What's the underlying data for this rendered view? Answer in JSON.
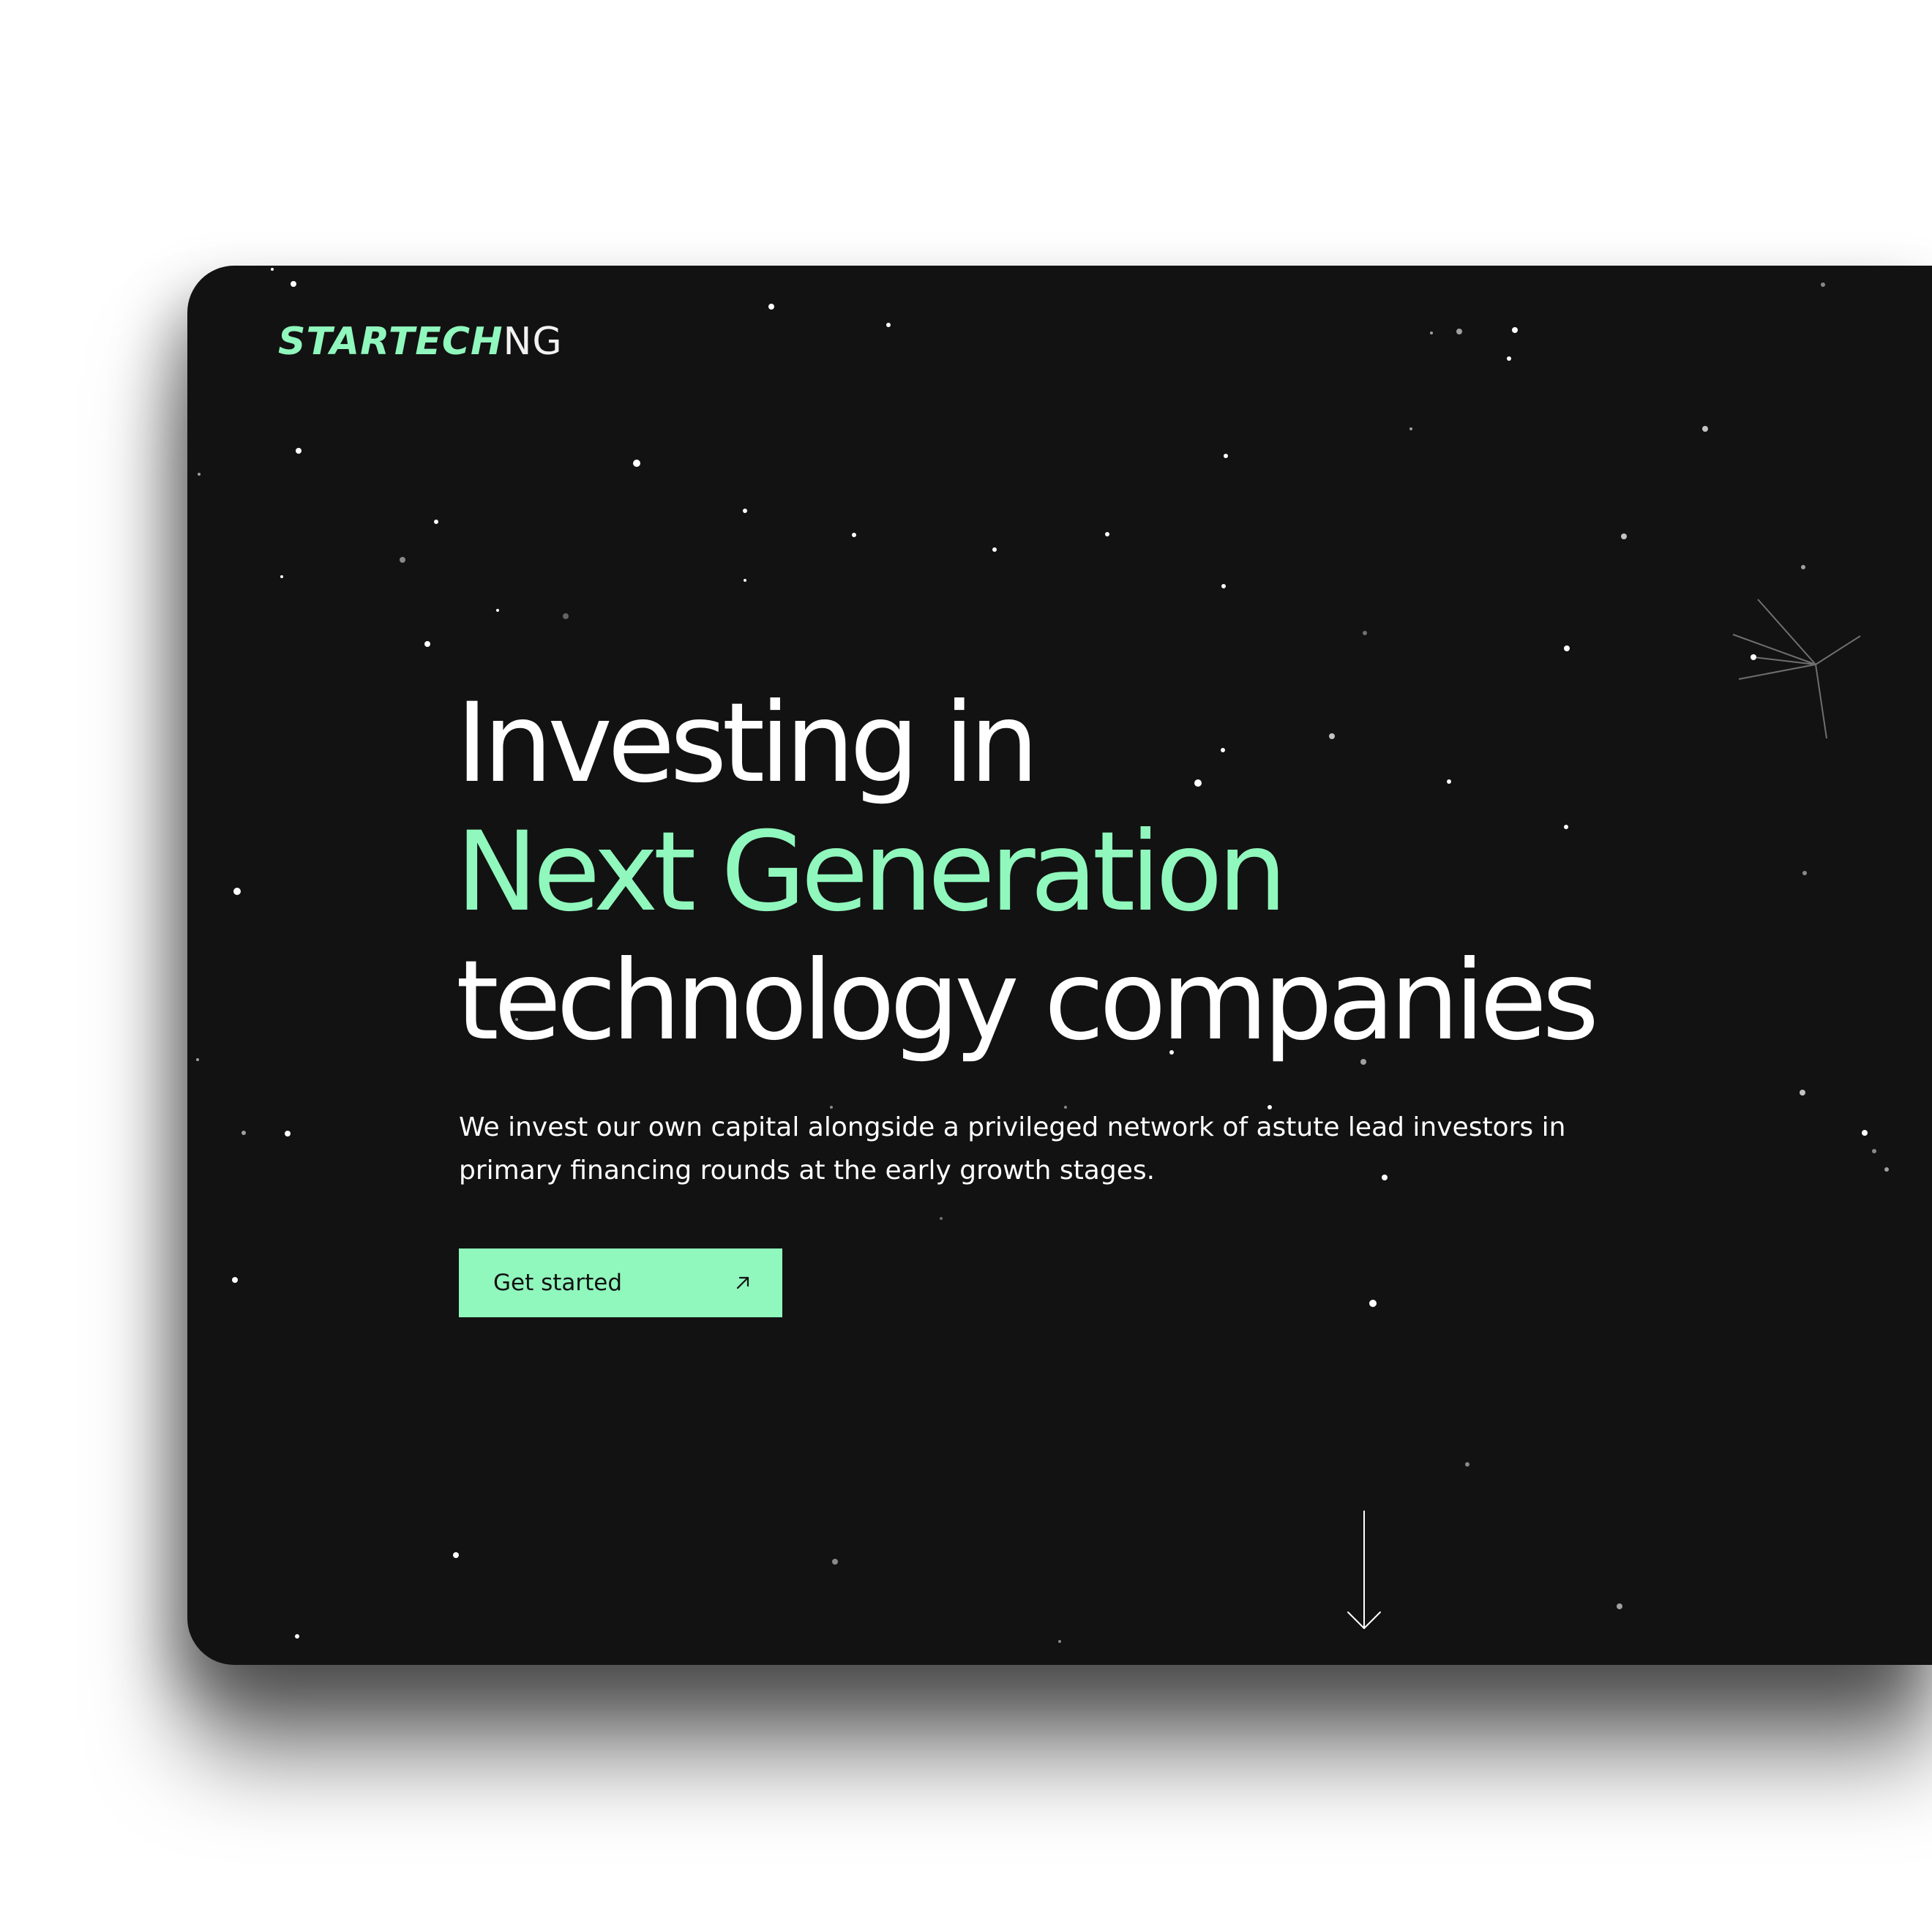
{
  "brand": {
    "name_bold": "STARTECH",
    "name_light": "NG",
    "accent_color": "#90f7bd"
  },
  "hero": {
    "headline_line1": "Investing in",
    "headline_line2": "Next Generation",
    "headline_line3": "technology companies",
    "subtitle": "We invest our own capital alongside a privileged network of astute lead investors in primary financing rounds at the early growth stages.",
    "cta_label": "Get started",
    "cta_icon": "arrow-up-right-icon"
  },
  "scroll_indicator": {
    "icon": "arrow-down-icon"
  },
  "background": {
    "color": "#121212",
    "decor": "starfield"
  }
}
